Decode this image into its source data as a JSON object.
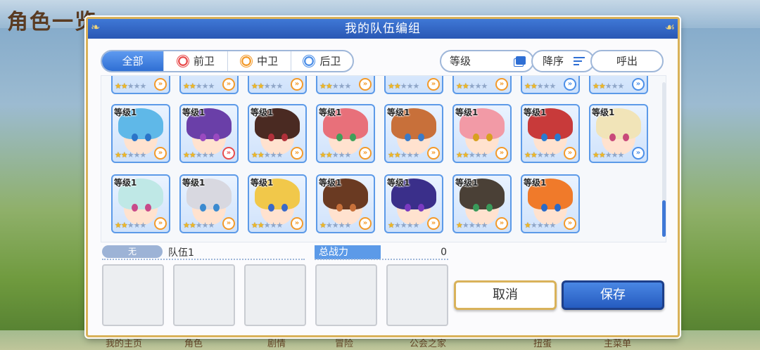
{
  "background": {
    "screen_title": "角色一览",
    "bottom_nav": [
      "我的主页",
      "角色",
      "剧情",
      "冒险",
      "公会之家",
      "扭蛋",
      "主菜单"
    ]
  },
  "dialog": {
    "title": "我的队伍编组"
  },
  "filters": {
    "tabs": [
      {
        "label": "全部",
        "icon": null,
        "active": true
      },
      {
        "label": "前卫",
        "icon": "front-role-icon",
        "active": false
      },
      {
        "label": "中卫",
        "icon": "middle-role-icon",
        "active": false
      },
      {
        "label": "后卫",
        "icon": "back-role-icon",
        "active": false
      }
    ],
    "sort_stat_label": "等级",
    "sort_order_label": "降序",
    "call_out_label": "呼出"
  },
  "characters": {
    "top_row": [
      {
        "stars": 2,
        "role": "middle"
      },
      {
        "stars": 2,
        "role": "middle"
      },
      {
        "stars": 2,
        "role": "middle"
      },
      {
        "stars": 2,
        "role": "middle"
      },
      {
        "stars": 2,
        "role": "middle"
      },
      {
        "stars": 2,
        "role": "middle"
      },
      {
        "stars": 2,
        "role": "back"
      },
      {
        "stars": 2,
        "role": "back"
      }
    ],
    "rows": [
      [
        {
          "level": "等级1",
          "stars": 2,
          "role": "middle",
          "hair": "#5fb8e8",
          "eyes": "#2b74c8"
        },
        {
          "level": "等级1",
          "stars": 2,
          "role": "front",
          "hair": "#6a3fa8",
          "eyes": "#9a4ac0"
        },
        {
          "level": "等级1",
          "stars": 2,
          "role": "middle",
          "hair": "#4a2a22",
          "eyes": "#b0303a"
        },
        {
          "level": "等级1",
          "stars": 2,
          "role": "middle",
          "hair": "#e8707a",
          "eyes": "#3fa05a"
        },
        {
          "level": "等级1",
          "stars": 2,
          "role": "middle",
          "hair": "#c8703a",
          "eyes": "#3a7ac8"
        },
        {
          "level": "等级1",
          "stars": 2,
          "role": "middle",
          "hair": "#f29aa6",
          "eyes": "#d8a020"
        },
        {
          "level": "等级1",
          "stars": 2,
          "role": "middle",
          "hair": "#c83a3a",
          "eyes": "#2a7ad0"
        },
        {
          "level": "等级1",
          "stars": 2,
          "role": "back",
          "hair": "#f1e4b8",
          "eyes": "#c84a7a"
        }
      ],
      [
        {
          "level": "等级1",
          "stars": 2,
          "role": "middle",
          "hair": "#bfe8e6",
          "eyes": "#c84a8a"
        },
        {
          "level": "等级1",
          "stars": 2,
          "role": "middle",
          "hair": "#d8d8e0",
          "eyes": "#3a8ad0"
        },
        {
          "level": "等级1",
          "stars": 2,
          "role": "middle",
          "hair": "#f1c84a",
          "eyes": "#3a6ac8"
        },
        {
          "level": "等级1",
          "stars": 1,
          "role": "middle",
          "hair": "#6a3a22",
          "eyes": "#c8703a"
        },
        {
          "level": "等级1",
          "stars": 1,
          "role": "middle",
          "hair": "#3a2f8a",
          "eyes": "#7a3ac0"
        },
        {
          "level": "等级1",
          "stars": 1,
          "role": "middle",
          "hair": "#4a4036",
          "eyes": "#3a9a5a"
        },
        {
          "level": "等级1",
          "stars": 1,
          "role": "middle",
          "hair": "#f07a2a",
          "eyes": "#2a6ac8"
        }
      ]
    ]
  },
  "team": {
    "tag": "无",
    "name": "队伍1",
    "power_label": "总战力",
    "power_value": "0",
    "slot_count": 5
  },
  "buttons": {
    "cancel": "取消",
    "save": "保存"
  },
  "colors": {
    "accent_blue": "#3f78d6",
    "gold_border": "#d9b25a",
    "star": "#f0b825"
  }
}
